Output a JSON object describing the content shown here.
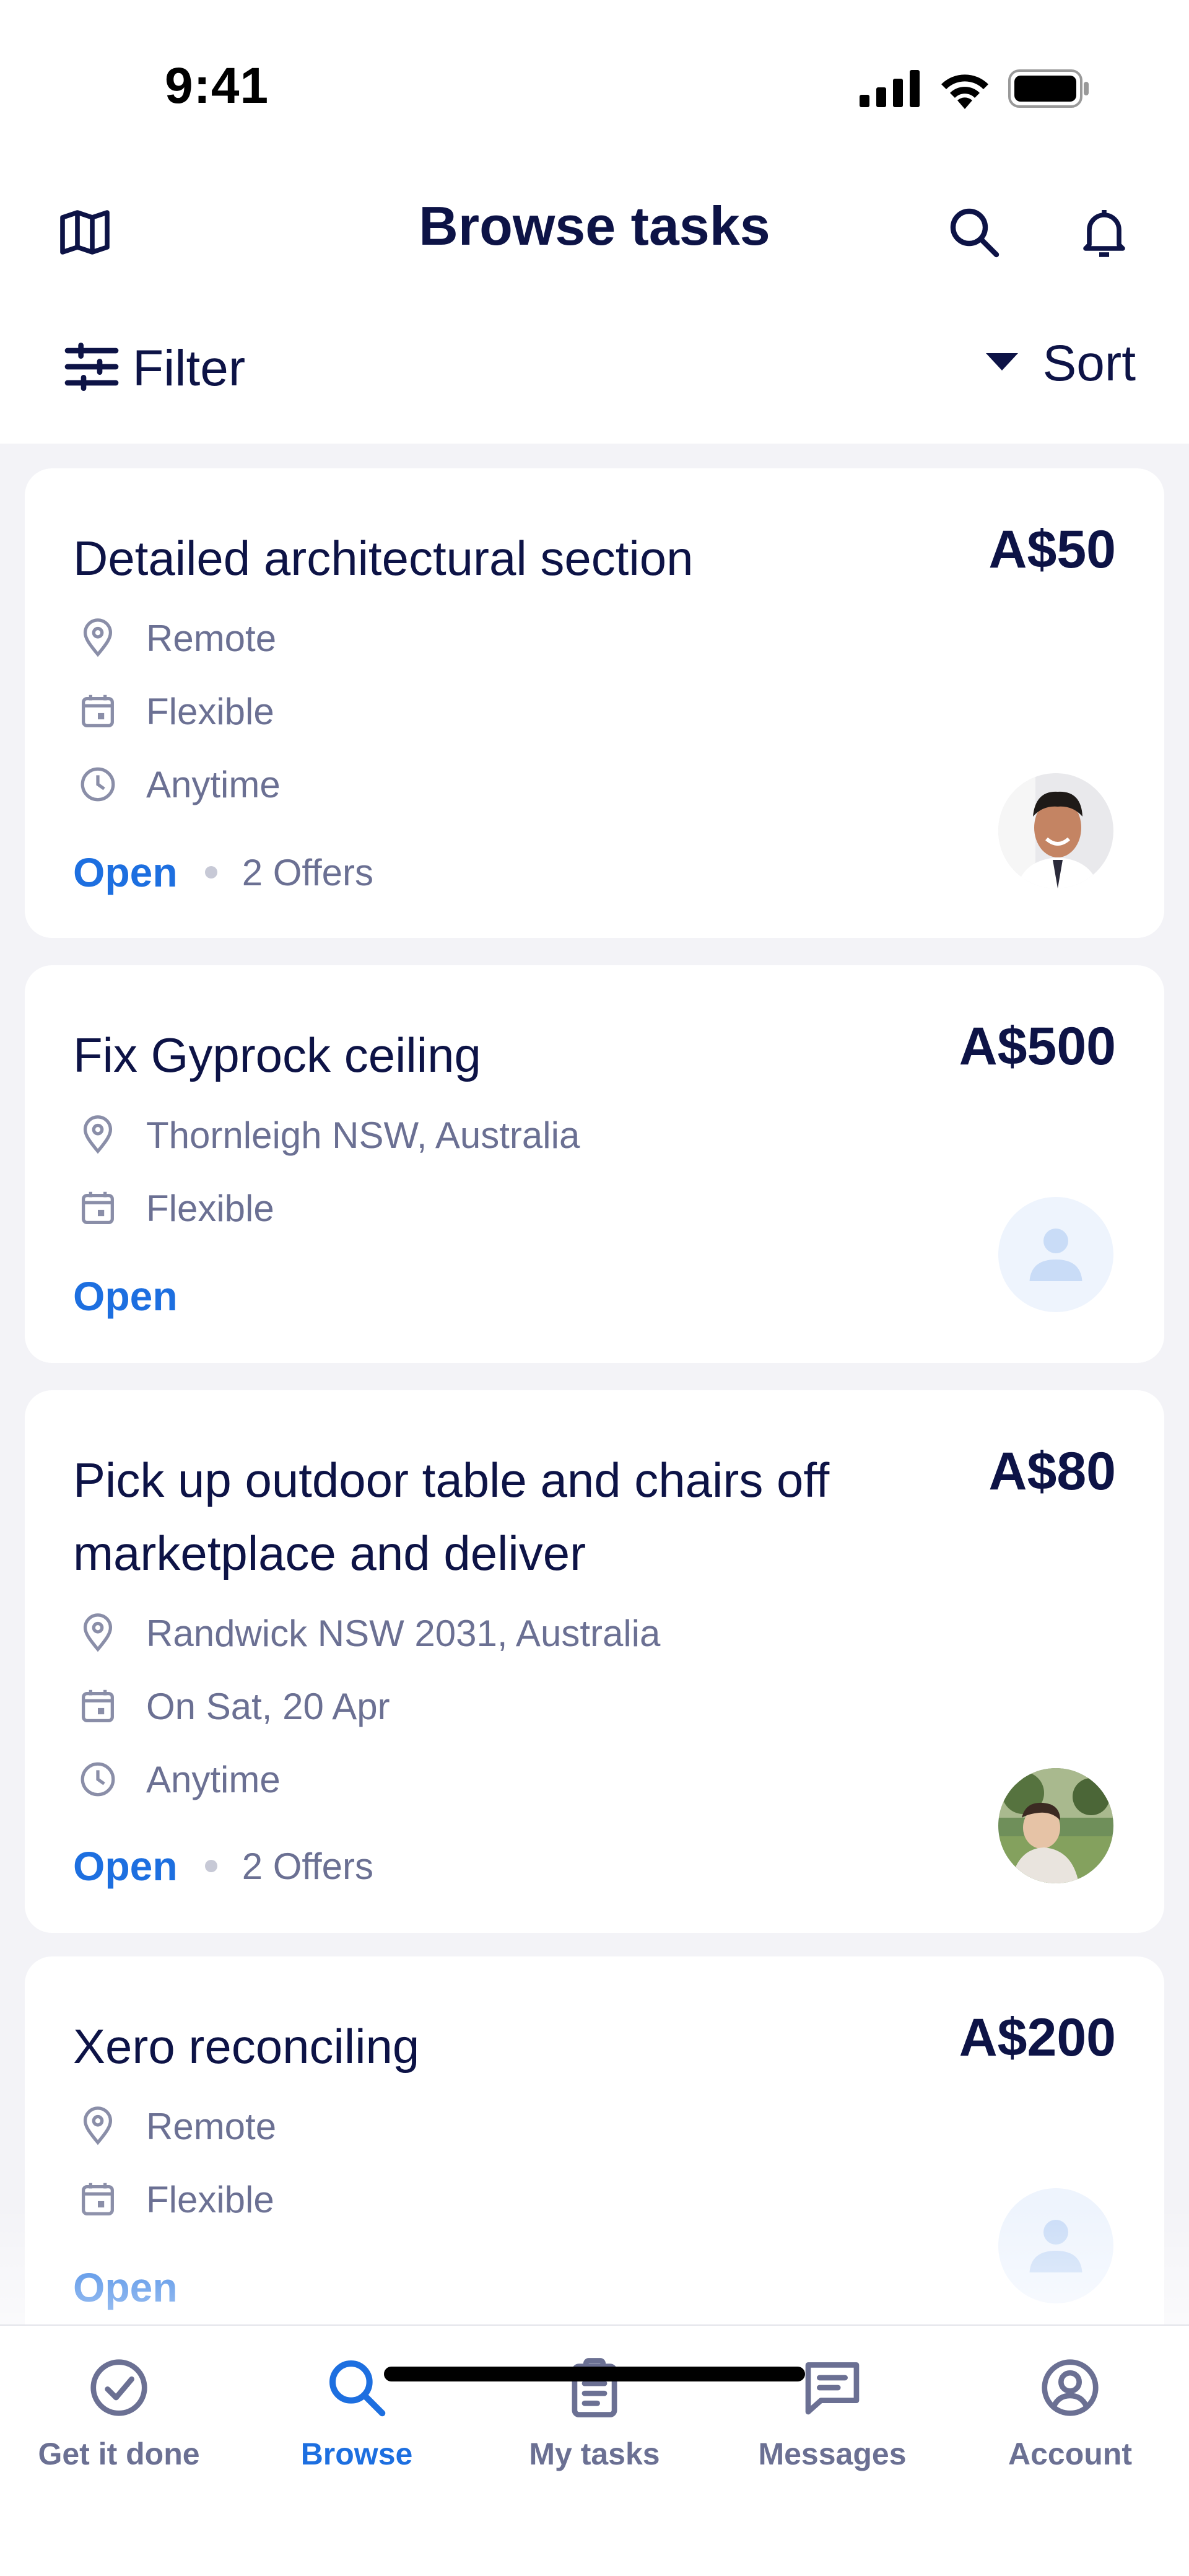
{
  "status_bar": {
    "time": "9:41",
    "icons": [
      "cellular-signal-icon",
      "wifi-icon",
      "battery-icon"
    ]
  },
  "header": {
    "title": "Browse tasks",
    "left_icon": "map-icon",
    "right_icons": [
      "search-icon",
      "bell-icon"
    ]
  },
  "toolbar": {
    "filter_label": "Filter",
    "sort_label": "Sort"
  },
  "tasks": [
    {
      "title": "Detailed architectural section",
      "price": "A$50",
      "location": "Remote",
      "date": "Flexible",
      "time": "Anytime",
      "status": "Open",
      "offers": "2 Offers",
      "avatar": "photo"
    },
    {
      "title": "Fix Gyprock ceiling",
      "price": "A$500",
      "location": "Thornleigh NSW, Australia",
      "date": "Flexible",
      "status": "Open",
      "avatar": "placeholder"
    },
    {
      "title": "Pick up outdoor table and chairs off marketplace and deliver",
      "price": "A$80",
      "location": "Randwick NSW 2031, Australia",
      "date": "On Sat, 20 Apr",
      "time": "Anytime",
      "status": "Open",
      "offers": "2 Offers",
      "avatar": "photo"
    },
    {
      "title": "Xero reconciling",
      "price": "A$200",
      "location": "Remote",
      "date": "Flexible",
      "status": "Open",
      "avatar": "placeholder"
    }
  ],
  "tabbar": {
    "items": [
      {
        "label": "Get it done",
        "icon": "check-circle-icon"
      },
      {
        "label": "Browse",
        "icon": "search-icon",
        "active": true
      },
      {
        "label": "My tasks",
        "icon": "clipboard-icon"
      },
      {
        "label": "Messages",
        "icon": "message-icon"
      },
      {
        "label": "Account",
        "icon": "account-icon"
      }
    ]
  },
  "colors": {
    "accent": "#1d6fe0",
    "text": "#0d1346",
    "muted": "#6b7093",
    "background": "#f3f3f7"
  }
}
